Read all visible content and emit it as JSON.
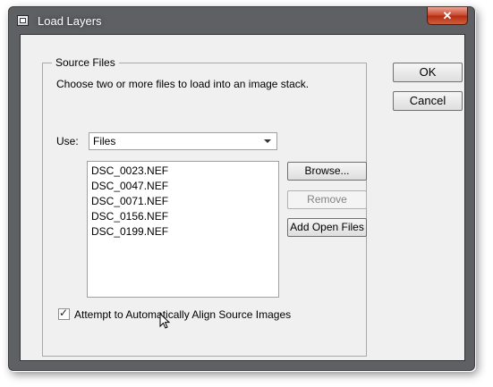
{
  "window": {
    "title": "Load Layers",
    "icon": "window-app-icon",
    "close_label": "✕"
  },
  "source_files": {
    "legend": "Source Files",
    "description": "Choose two or more files to load into an image stack.",
    "use_label": "Use:",
    "use_value": "Files",
    "files": [
      "DSC_0023.NEF",
      "DSC_0047.NEF",
      "DSC_0071.NEF",
      "DSC_0156.NEF",
      "DSC_0199.NEF"
    ],
    "browse_label": "Browse...",
    "remove_label": "Remove",
    "add_open_label": "Add Open Files",
    "align_checkbox_label": "Attempt to Automatically Align Source Images",
    "align_checked": true
  },
  "actions": {
    "ok_label": "OK",
    "cancel_label": "Cancel"
  },
  "colors": {
    "title_bar": "#5f6063",
    "dialog_bg": "#f0f0f0",
    "close_button": "#c8432a"
  }
}
